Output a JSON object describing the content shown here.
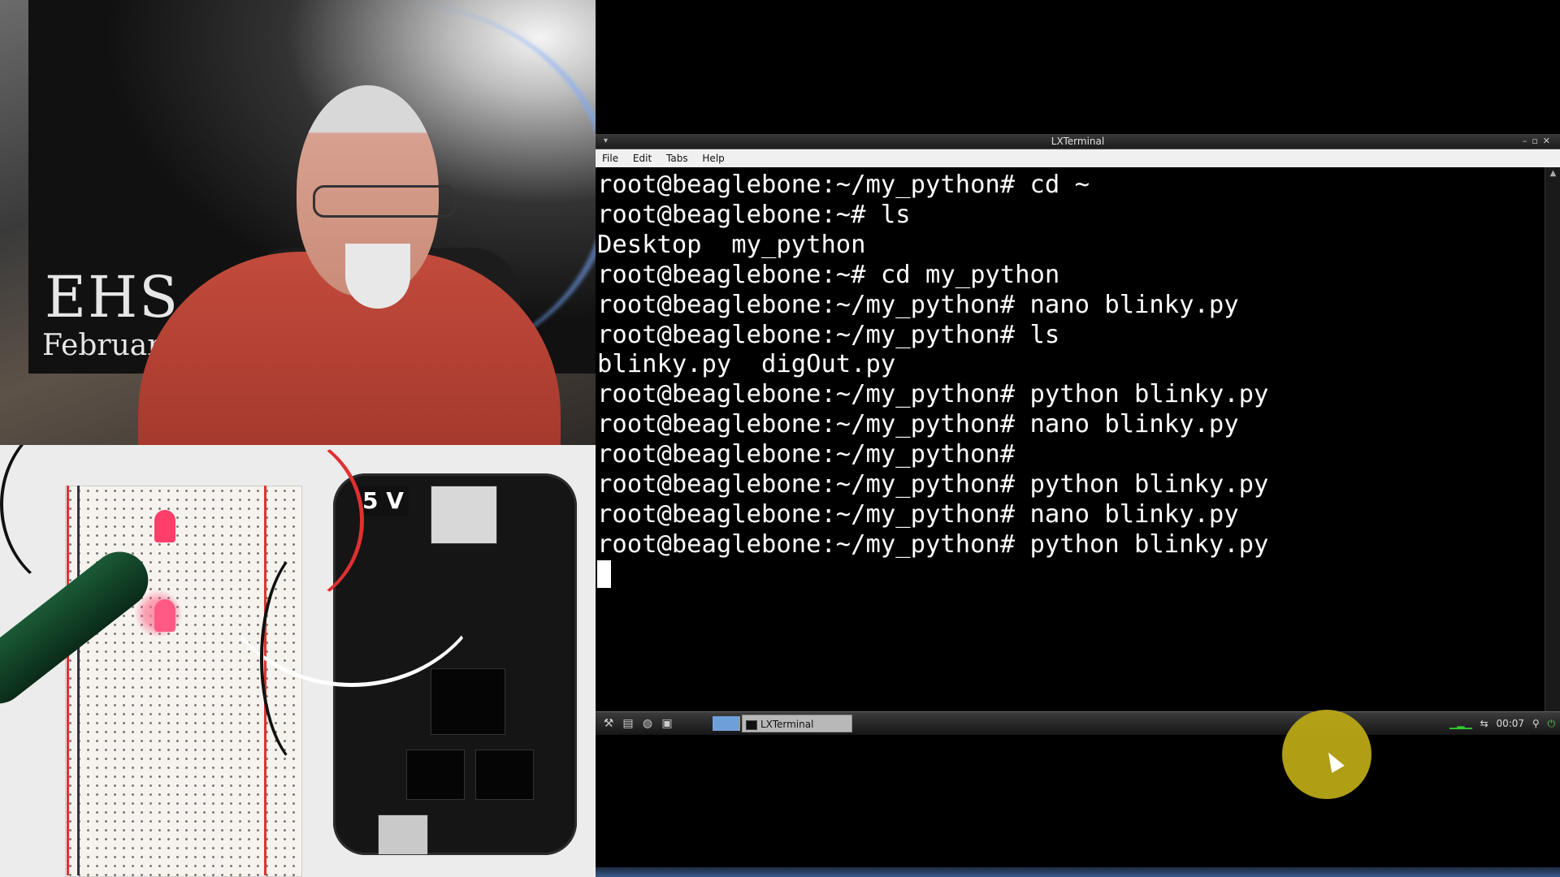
{
  "webcam": {
    "poster_title": "EHS -",
    "poster_subtitle": "February",
    "board_label": "5 V"
  },
  "terminal_window": {
    "title": "LXTerminal",
    "menu": [
      "File",
      "Edit",
      "Tabs",
      "Help"
    ],
    "lines": [
      "root@beaglebone:~/my_python# cd ~",
      "root@beaglebone:~# ls",
      "Desktop  my_python",
      "root@beaglebone:~# cd my_python",
      "root@beaglebone:~/my_python# nano blinky.py",
      "root@beaglebone:~/my_python# ls",
      "blinky.py  digOut.py",
      "root@beaglebone:~/my_python# python blinky.py",
      "root@beaglebone:~/my_python# nano blinky.py",
      "root@beaglebone:~/my_python#",
      "root@beaglebone:~/my_python# python blinky.py",
      "root@beaglebone:~/my_python# nano blinky.py",
      "root@beaglebone:~/my_python# python blinky.py"
    ]
  },
  "taskbar": {
    "task_label": "LXTerminal",
    "clock": "00:07"
  }
}
